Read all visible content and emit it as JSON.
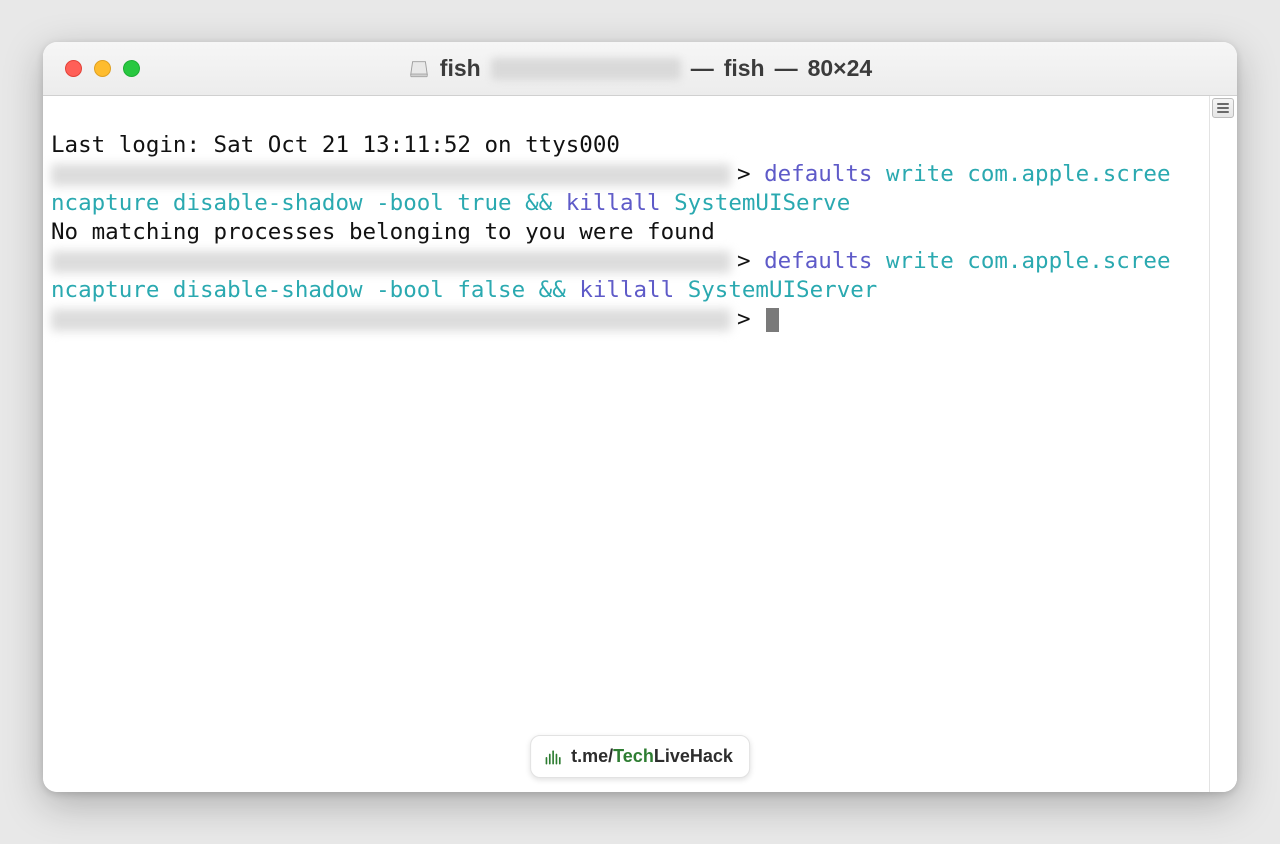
{
  "window": {
    "title_prefix": "fish",
    "title_sep": "—",
    "title_shell": "fish",
    "title_size": "80×24"
  },
  "terminal": {
    "last_login": "Last login: Sat Oct 21 13:11:52 on ttys000",
    "line1": {
      "chev": ">",
      "cmd1": "defaults",
      "args1": "write com.apple.scree",
      "wrap": "ncapture disable-shadow -bool true",
      "op": "&&",
      "cmd2": "killall",
      "args2": "SystemUIServe"
    },
    "output1": "No matching processes belonging to you were found",
    "line2": {
      "chev": ">",
      "cmd1": "defaults",
      "args1": "write com.apple.scree",
      "wrap": "ncapture disable-shadow -bool false",
      "op": "&&",
      "cmd2": "killall",
      "args2": "SystemUIServer"
    },
    "line3": {
      "chev": ">"
    }
  },
  "watermark": {
    "prefix": "t.me/",
    "brand1": "Tech",
    "brand2": "LiveHack"
  }
}
